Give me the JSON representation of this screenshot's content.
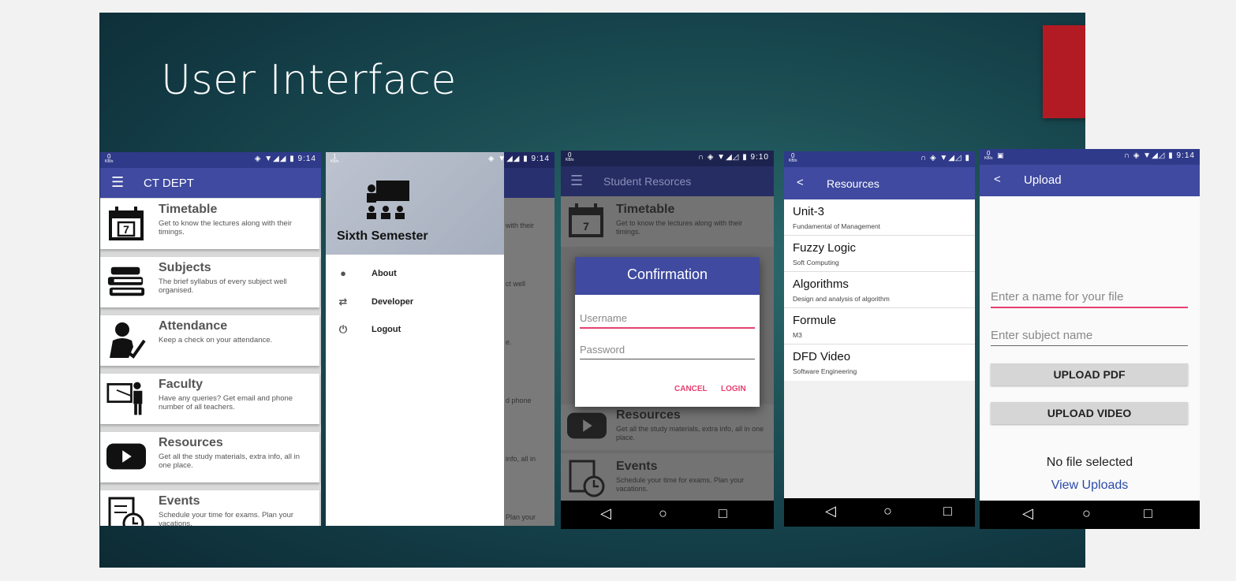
{
  "slide": {
    "title": "User Interface"
  },
  "phone1": {
    "status": {
      "kbs_top": "0",
      "kbs_bottom": "KB/s",
      "time": "9:14"
    },
    "appbar_title": "CT DEPT",
    "cards": [
      {
        "title": "Timetable",
        "desc": "Get to know the lectures along with their timings.",
        "icon": "calendar-icon",
        "date": "7"
      },
      {
        "title": "Subjects",
        "desc": "The brief syllabus of every subject well organised.",
        "icon": "books-icon"
      },
      {
        "title": "Attendance",
        "desc": "Keep a check on your attendance.",
        "icon": "attendance-icon"
      },
      {
        "title": "Faculty",
        "desc": "Have any queries? Get email and phone number of all teachers.",
        "icon": "teacher-icon"
      },
      {
        "title": "Resources",
        "desc": "Get all the study materials, extra info, all in one place.",
        "icon": "play-icon"
      },
      {
        "title": "Events",
        "desc": "Schedule your time for exams. Plan your vacations.",
        "icon": "schedule-icon"
      }
    ]
  },
  "phone2": {
    "status": {
      "kbs_top": "1",
      "kbs_bottom": "KB/s",
      "time": "9:14"
    },
    "drawer_title": "Sixth Semester",
    "items": [
      {
        "label": "About",
        "icon": "info-icon"
      },
      {
        "label": "Developer",
        "icon": "code-icon"
      },
      {
        "label": "Logout",
        "icon": "power-icon"
      }
    ],
    "behind_snippets": [
      "with their",
      "ct well",
      "e.",
      "d phone",
      "info, all in",
      "Plan your"
    ]
  },
  "phone3": {
    "status": {
      "kbs_top": "0",
      "kbs_bottom": "KB/s",
      "time": "9:10"
    },
    "appbar_title": "Student Resorces",
    "dialog": {
      "title": "Confirmation",
      "username_placeholder": "Username",
      "password_placeholder": "Password",
      "cancel": "CANCEL",
      "login": "LOGIN"
    },
    "cards": [
      {
        "title": "Timetable",
        "desc": "Get to know the lectures along with their timings."
      },
      {
        "title": "Resources",
        "desc": "Get all the study materials, extra info, all in one place."
      },
      {
        "title": "Events",
        "desc": "Schedule your time for exams. Plan your vacations."
      }
    ]
  },
  "phone4": {
    "status": {
      "kbs_top": "0",
      "kbs_bottom": "KB/s"
    },
    "appbar_title": "Resources",
    "items": [
      {
        "title": "Unit-3",
        "subtitle": "Fundamental of Management"
      },
      {
        "title": "Fuzzy Logic",
        "subtitle": "Soft Computing"
      },
      {
        "title": "Algorithms",
        "subtitle": "Design and analysis of algorithm"
      },
      {
        "title": "Formule",
        "subtitle": "M3"
      },
      {
        "title": "DFD Video",
        "subtitle": "Software Engineering"
      }
    ]
  },
  "phone5": {
    "status": {
      "kbs_top": "0",
      "kbs_bottom": "KB/s",
      "time": "9:14"
    },
    "appbar_title": "Upload",
    "file_name_placeholder": "Enter a name for your file",
    "subject_placeholder": "Enter subject name",
    "upload_pdf": "UPLOAD PDF",
    "upload_video": "UPLOAD VIDEO",
    "status_text": "No file selected",
    "view_uploads": "View Uploads"
  },
  "navbar": {
    "back": "◁",
    "home": "○",
    "recents": "□"
  },
  "colors": {
    "appbar": "#3f4aa0",
    "accent": "#e5406f",
    "slide_bg": "#1c4f55",
    "red_bar": "#b21b24",
    "link": "#2b4aa8"
  }
}
